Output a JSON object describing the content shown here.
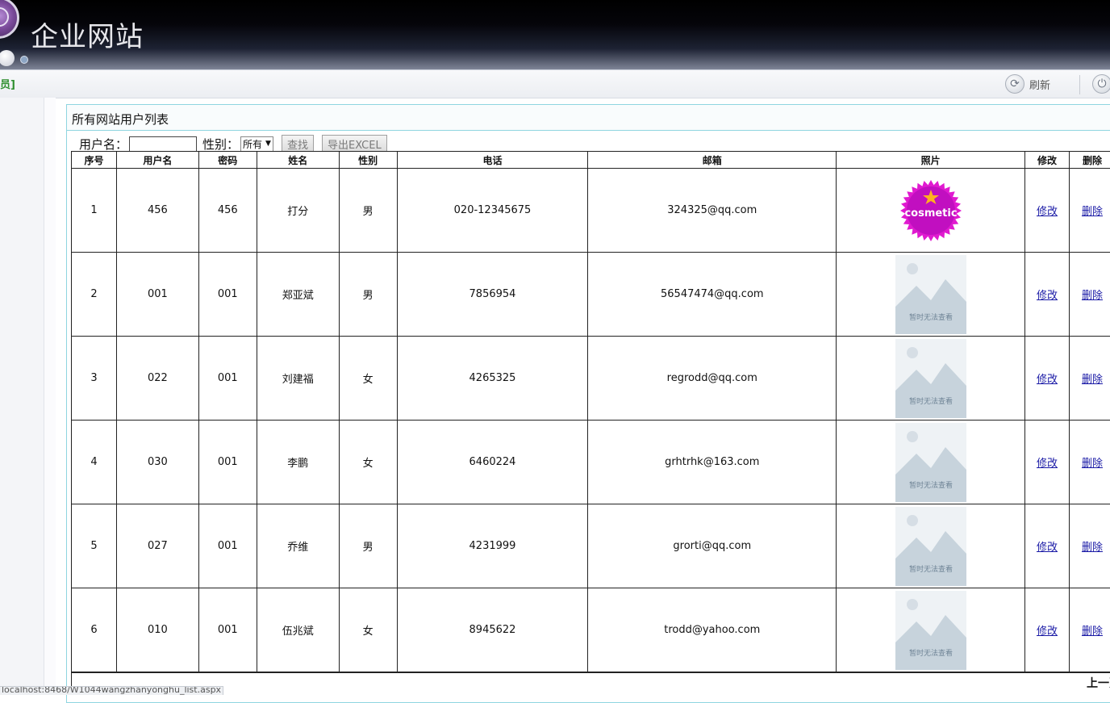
{
  "header": {
    "site_title": "企业网站"
  },
  "toolbar": {
    "role_label": "员]",
    "refresh_label": "刷新",
    "refresh_icon": "refresh-icon",
    "power_icon": "power-icon"
  },
  "panel": {
    "title": "所有网站用户列表",
    "search": {
      "username_label": "用户名：",
      "username_value": "",
      "gender_label": "性别：",
      "gender_selected": "所有",
      "search_button": "查找",
      "export_button": "导出EXCEL"
    }
  },
  "table": {
    "headers": [
      "序号",
      "用户名",
      "密码",
      "姓名",
      "性别",
      "电话",
      "邮箱",
      "照片",
      "修改",
      "删除"
    ],
    "edit_label": "修改",
    "delete_label": "删除",
    "rows": [
      {
        "no": "1",
        "username": "456",
        "password": "456",
        "name": "打分",
        "gender": "男",
        "phone": "020-12345675",
        "email": "324325@qq.com",
        "photo": "cosmetic"
      },
      {
        "no": "2",
        "username": "001",
        "password": "001",
        "name": "郑亚斌",
        "gender": "男",
        "phone": "7856954",
        "email": "56547474@qq.com",
        "photo": "placeholder"
      },
      {
        "no": "3",
        "username": "022",
        "password": "001",
        "name": "刘建福",
        "gender": "女",
        "phone": "4265325",
        "email": "regrodd@qq.com",
        "photo": "placeholder"
      },
      {
        "no": "4",
        "username": "030",
        "password": "001",
        "name": "李鹏",
        "gender": "女",
        "phone": "6460224",
        "email": "grhtrhk@163.com",
        "photo": "placeholder"
      },
      {
        "no": "5",
        "username": "027",
        "password": "001",
        "name": "乔维",
        "gender": "男",
        "phone": "4231999",
        "email": "grorti@qq.com",
        "photo": "placeholder"
      },
      {
        "no": "6",
        "username": "010",
        "password": "001",
        "name": "伍兆斌",
        "gender": "女",
        "phone": "8945622",
        "email": "trodd@yahoo.com",
        "photo": "placeholder"
      }
    ],
    "cosmetic_text": "cosmetic",
    "placeholder_text": "暂时无法查看"
  },
  "pager": {
    "prev_label": "上一页"
  },
  "statusbar": {
    "url": "localhost:8468/W1044wangzhanyonghu_list.aspx"
  }
}
